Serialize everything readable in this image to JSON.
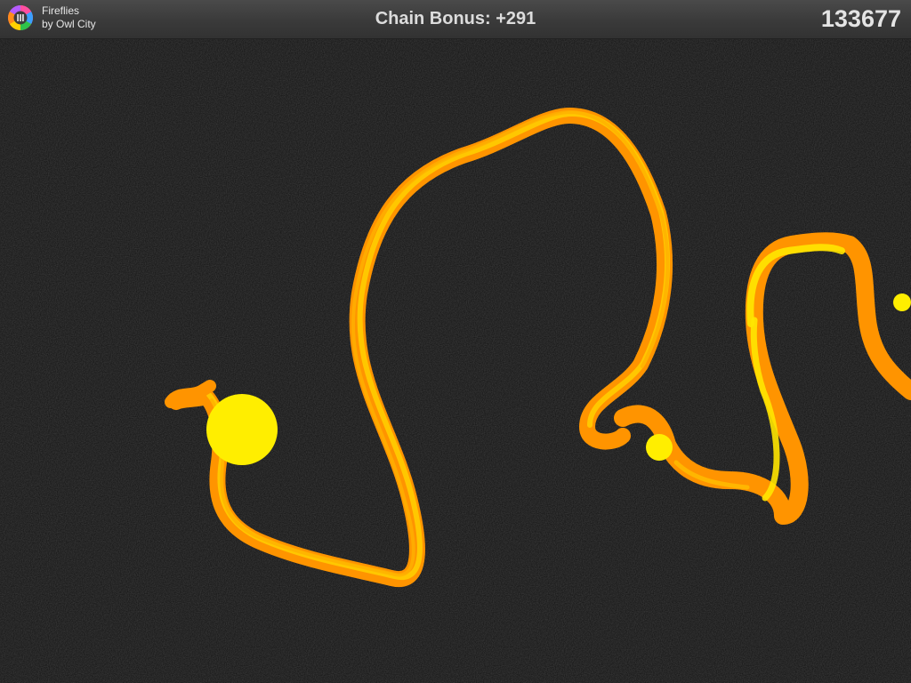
{
  "song": {
    "title": "Fireflies",
    "artist": "by Owl City",
    "icon": "song-wheel-icon"
  },
  "chain_bonus_label": "Chain Bonus: +291",
  "score": "133677",
  "colors": {
    "trail_orange": "#ff9400",
    "trail_yellow": "#ffe600",
    "firefly": "#ffee00",
    "background": "#1d1d1d"
  },
  "fireflies": [
    {
      "name": "firefly-large",
      "size": "large"
    },
    {
      "name": "firefly-small-middle",
      "size": "small"
    },
    {
      "name": "firefly-small-right",
      "size": "small"
    }
  ]
}
